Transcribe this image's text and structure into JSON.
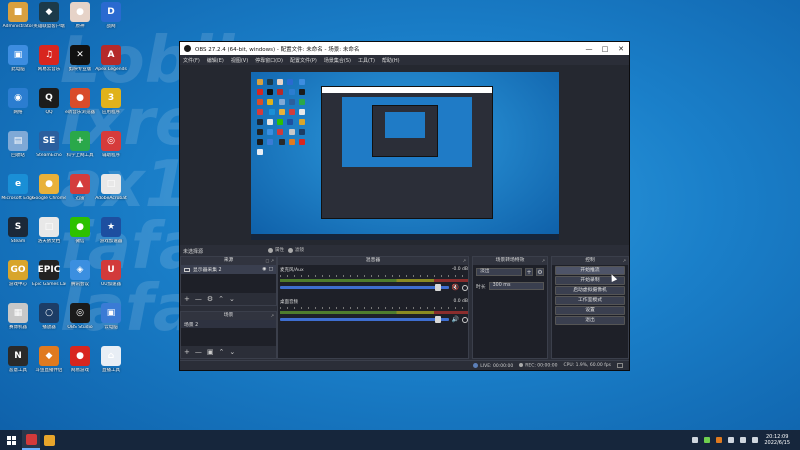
{
  "wallpaper_text": "Lobli\nixrem\nax1lan\nfafany\nlafany",
  "desktop": {
    "icons": [
      {
        "label": "Administrator",
        "color": "#d9a03f",
        "glyph": "■"
      },
      {
        "label": "英雄联盟客户端",
        "color": "#1c3a4a",
        "glyph": "◆"
      },
      {
        "label": "原神",
        "color": "#e6d3c8",
        "glyph": "●"
      },
      {
        "label": "战网",
        "color": "#2a6ad0",
        "glyph": "D"
      },
      {
        "label": "此电脑",
        "color": "#3d8de0",
        "glyph": "▣"
      },
      {
        "label": "网易云音乐",
        "color": "#d8261f",
        "glyph": "♫"
      },
      {
        "label": "剪映专业版",
        "color": "#111111",
        "glyph": "✕"
      },
      {
        "label": "Apex Legends",
        "color": "#b52a2a",
        "glyph": "A"
      },
      {
        "label": "网络",
        "color": "#2b7dd0",
        "glyph": "◉"
      },
      {
        "label": "QQ",
        "color": "#1c1c1c",
        "glyph": "Q"
      },
      {
        "label": "e听音乐浏览器",
        "color": "#d94c2a",
        "glyph": "●"
      },
      {
        "label": "应用程序",
        "color": "#e0b21b",
        "glyph": "3"
      },
      {
        "label": "回收站",
        "color": "#7fa9d6",
        "glyph": "▤"
      },
      {
        "label": "SteamEcho",
        "color": "#2b5f9e",
        "glyph": "SE"
      },
      {
        "label": "科学上网工具",
        "color": "#2aa84a",
        "glyph": "+"
      },
      {
        "label": "辅助程序",
        "color": "#d63b3b",
        "glyph": "◎"
      },
      {
        "label": "Microsoft Edge",
        "color": "#1a8fd6",
        "glyph": "e"
      },
      {
        "label": "Google Chrome",
        "color": "#e8b13a",
        "glyph": "●"
      },
      {
        "label": "迅雷",
        "color": "#d43c3c",
        "glyph": "▲"
      },
      {
        "label": "AdobeAcrobat",
        "color": "#e8e8e8",
        "glyph": "□"
      },
      {
        "label": "Steam",
        "color": "#1b2838",
        "glyph": "S"
      },
      {
        "label": "洛天依文档",
        "color": "#e8e8e8",
        "glyph": "□"
      },
      {
        "label": "微信",
        "color": "#2dc100",
        "glyph": "●"
      },
      {
        "label": "游戏加速器",
        "color": "#1d4fa0",
        "glyph": "★"
      },
      {
        "label": "游戏中心",
        "color": "#d8a52b",
        "glyph": "GO"
      },
      {
        "label": "Epic Games Launcher",
        "color": "#222222",
        "glyph": "EPIC"
      },
      {
        "label": "腾讯会议",
        "color": "#3b8fe0",
        "glyph": "◈"
      },
      {
        "label": "UU加速器",
        "color": "#d23a3a",
        "glyph": "U"
      },
      {
        "label": "赛博机器",
        "color": "#c8c8c8",
        "glyph": "▦"
      },
      {
        "label": "播放器",
        "color": "#1d3d66",
        "glyph": "○"
      },
      {
        "label": "OBS Studio",
        "color": "#1a1a1a",
        "glyph": "◎"
      },
      {
        "label": "云电脑",
        "color": "#3a7bd5",
        "glyph": "▣"
      },
      {
        "label": "恶意工具",
        "color": "#2a2a2a",
        "glyph": "N"
      },
      {
        "label": "斗鱼直播伴侣",
        "color": "#e07a1f",
        "glyph": "◆"
      },
      {
        "label": "网易游戏",
        "color": "#d8261f",
        "glyph": "●"
      },
      {
        "label": "直播工具",
        "color": "#e8eef5",
        "glyph": "⌂"
      }
    ]
  },
  "obs": {
    "window_title": "OBS 27.2.4 (64-bit, windows) - 配置文件: 未命名 - 场景: 未命名",
    "menu": [
      "文件(F)",
      "编辑(E)",
      "视图(V)",
      "停靠窗口(D)",
      "配置文件(P)",
      "场景集合(S)",
      "工具(T)",
      "帮助(H)"
    ],
    "no_source_selected": "未选择源",
    "filter_buttons": [
      "属性",
      "滤镜"
    ],
    "sources": {
      "title": "来源",
      "items": [
        {
          "name": "显示器采集 2"
        }
      ]
    },
    "scenes": {
      "title": "场景",
      "items": [
        {
          "name": "场景 2"
        }
      ]
    },
    "mixer": {
      "title": "混音器",
      "tracks": [
        {
          "name": "麦克风/Aux",
          "db": "-0.0 dB",
          "muted": true
        },
        {
          "name": "桌面音频",
          "db": "0.0 dB",
          "muted": false
        }
      ]
    },
    "transitions": {
      "title": "场景转场特效",
      "type": "淡出",
      "duration_label": "时长",
      "duration": "300 ms"
    },
    "controls": {
      "title": "控制",
      "buttons": [
        "开始推流",
        "开始录制",
        "启动虚拟摄像机",
        "工作室模式",
        "设置",
        "退出"
      ]
    },
    "status": {
      "live": "LIVE: 00:00:00",
      "rec": "REC: 00:00:00",
      "cpu": "CPU: 1.9%, 60.00 fps"
    }
  },
  "taskbar": {
    "apps": [
      {
        "name": "obs",
        "color": "#d33a3a",
        "active": true
      },
      {
        "name": "file-explorer",
        "color": "#e8a52b",
        "active": false
      }
    ],
    "clock_time": "20:12:09",
    "clock_date": "2022/6/15"
  }
}
